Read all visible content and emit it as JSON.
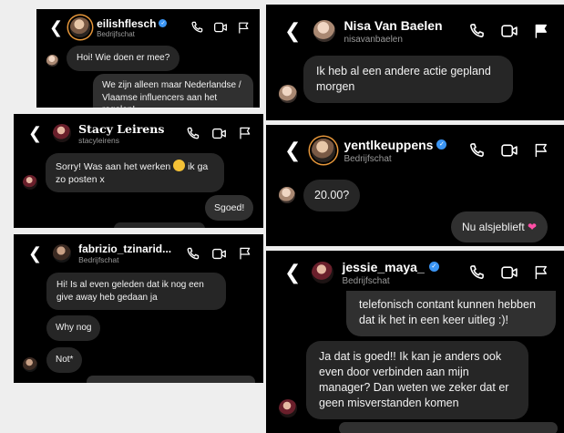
{
  "chats": [
    {
      "username": "eilishflesch",
      "subtitle": "Bedrijfschat",
      "verified": true,
      "messages": [
        {
          "dir": "in",
          "text": "Hoi! Wie doen er mee?"
        },
        {
          "dir": "out",
          "text": "We zijn alleen maar Nederlandse / Vlaamse influencers aan het regelen!"
        }
      ]
    },
    {
      "username": "Nisa Van Baelen",
      "subtitle": "nisavanbaelen",
      "verified": false,
      "messages": [
        {
          "dir": "in",
          "text": "Ik heb al een andere actie gepland morgen"
        }
      ]
    },
    {
      "username": "Stacy Leirens",
      "subtitle": "stacyleirens",
      "verified": false,
      "messages": [
        {
          "dir": "in",
          "text_before": "Sorry! Was aan het werken",
          "emoji": "grinning-face-emoji",
          "text_after": "ik ga zo posten x"
        },
        {
          "dir": "out",
          "text": "Sgoed!"
        }
      ]
    },
    {
      "username": "yentlkeuppens",
      "subtitle": "Bedrijfschat",
      "verified": true,
      "messages": [
        {
          "dir": "in",
          "text": "20.00?"
        },
        {
          "dir": "out",
          "text": "Nu alsjeblieft",
          "emoji": "pink-heart-emoji"
        }
      ]
    },
    {
      "username": "fabrizio_tzinarid...",
      "subtitle": "Bedrijfschat",
      "verified": false,
      "messages": [
        {
          "dir": "in",
          "text": "Hi! Is al even geleden dat ik nog een give away heb gedaan ja"
        },
        {
          "dir": "in",
          "text": "Why nog"
        },
        {
          "dir": "in",
          "text": "Not*"
        }
      ]
    },
    {
      "username": "jessie_maya_",
      "subtitle": "Bedrijfschat",
      "verified": true,
      "messages": [
        {
          "dir": "out",
          "text": "telefonisch contant kunnen hebben dat ik het in een keer uitleg :)!"
        },
        {
          "dir": "in",
          "text": "Ja dat is goed!! Ik kan je anders ook even door verbinden aan mijn manager? Dan weten we zeker dat er geen misverstanden komen"
        }
      ]
    }
  ],
  "icons": [
    "back-chevron-icon",
    "phone-icon",
    "video-camera-icon",
    "flag-icon",
    "verified-badge-icon"
  ],
  "colors": {
    "background": "#000000",
    "bubble": "#262626",
    "verified": "#3b95f3",
    "subtitle": "#9a9a9a",
    "page": "#eeeeee"
  }
}
